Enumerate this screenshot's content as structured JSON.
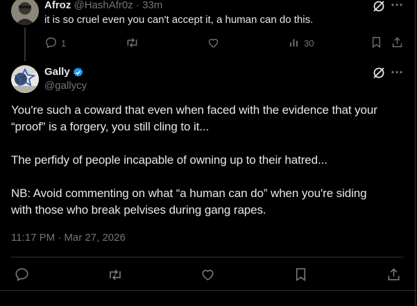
{
  "reply": {
    "author_name": "Afroz",
    "handle": "@HashAfr0z",
    "separator": "·",
    "time": "33m",
    "text": "it is so cruel even you can't accept it, a human can do this.",
    "reply_count": "1",
    "views_count": "30"
  },
  "main": {
    "author_name": "Gally",
    "handle": "@gallycy",
    "paragraphs": [
      "You're such a coward that even when faced with the evidence that your",
      "“proof” is a forgery, you still cling to it...",
      "The perfidy of people incapable of owning up to their hatred...",
      "NB: Avoid commenting on what “a human can do” when you're siding",
      "with those who break pelvises during gang rapes."
    ],
    "timestamp": "11:17 PM · Mar 27, 2026"
  },
  "colors": {
    "background": "#000000",
    "text": "#e7e9ea",
    "muted": "#71767b",
    "verified": "#1d9bf0",
    "divider": "#2f3336"
  },
  "icons": [
    "grok-icon",
    "more-icon",
    "reply-icon",
    "retweet-icon",
    "like-icon",
    "views-icon",
    "bookmark-icon",
    "share-icon",
    "verified-badge-icon"
  ]
}
